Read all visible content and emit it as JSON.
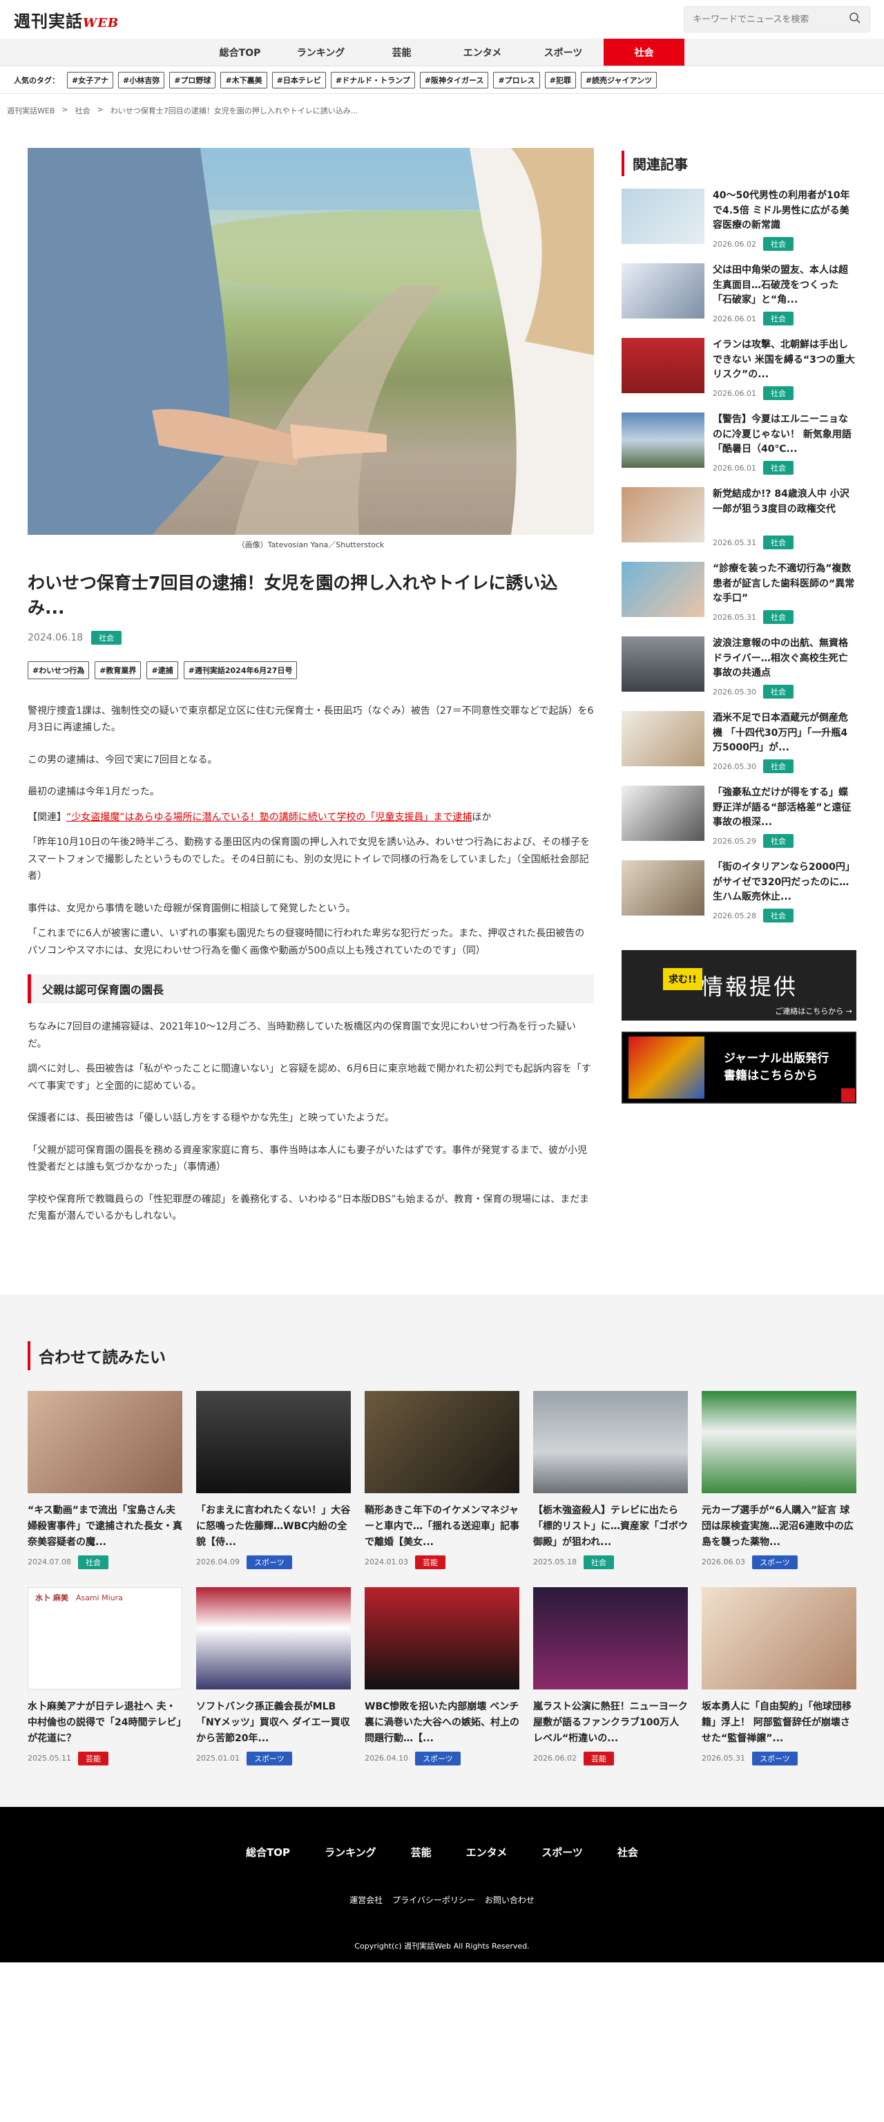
{
  "header": {
    "logo_text": "週刊実話",
    "logo_web": "WEB",
    "search_placeholder": "キーワードでニュースを検索"
  },
  "nav": {
    "items": [
      "総合TOP",
      "ランキング",
      "芸能",
      "エンタメ",
      "スポーツ",
      "社会"
    ],
    "active": "社会"
  },
  "popular_tags": {
    "label": "人気のタグ：",
    "items": [
      "#女子アナ",
      "#小林吉弥",
      "#プロ野球",
      "#木下裏美",
      "#日本テレビ",
      "#ドナルド・トランプ",
      "#阪神タイガース",
      "#プロレス",
      "#犯罪",
      "#読売ジャイアンツ"
    ]
  },
  "breadcrumb": {
    "items": [
      "週刊実話WEB",
      "社会",
      "わいせつ保育士7回目の逮捕！女児を園の押し入れやトイレに誘い込み..."
    ],
    "separator": ">"
  },
  "article": {
    "image_caption": "（画像）Tatevosian Yana／Shutterstock",
    "title": "わいせつ保育士7回目の逮捕！女児を園の押し入れやトイレに誘い込み...",
    "date": "2024.06.18",
    "category": "社会",
    "tags": [
      "#わいせつ行為",
      "#教育業界",
      "#逮捕",
      "#週刊実話2024年6月27日号"
    ],
    "p1": "警視庁捜査1課は、強制性交の疑いで東京都足立区に住む元保育士・長田凪巧（なぐみ）被告（27＝不同意性交罪などで起訴）を6月3日に再逮捕した。",
    "p2": "この男の逮捕は、今回で実に7回目となる。",
    "p3": "最初の逮捕は今年1月だった。",
    "related_prefix": "【関連】",
    "related_link": "“少女盗撮魔”はあらゆる場所に潜んでいる！塾の講師に続いて学校の「児童支援員」まで逮捕",
    "related_suffix": "ほか",
    "p4": "「昨年10月10日の午後2時半ごろ、勤務する墨田区内の保育園の押し入れで女児を誘い込み、わいせつ行為におよび、その様子をスマートフォンで撮影したというものでした。その4日前にも、別の女児にトイレで同様の行為をしていました」（全国紙社会部記者）",
    "p5": "事件は、女児から事情を聴いた母親が保育園側に相談して発覚したという。",
    "p6": "「これまでに6人が被害に遭い、いずれの事案も園児たちの昼寝時間に行われた卑劣な犯行だった。また、押収された長田被告のパソコンやスマホには、女児にわいせつ行為を働く画像や動画が500点以上も残されていたのです」（同）",
    "h2": "父親は認可保育園の園長",
    "p7": "ちなみに7回目の逮捕容疑は、2021年10～12月ごろ、当時勤務していた板橋区内の保育園で女児にわいせつ行為を行った疑いだ。",
    "p8": "調べに対し、長田被告は「私がやったことに間違いない」と容疑を認め、6月6日に東京地裁で開かれた初公判でも起訴内容を「すべて事実です」と全面的に認めている。",
    "p9": "保護者には、長田被告は「優しい話し方をする穏やかな先生」と映っていたようだ。",
    "p10": "「父親が認可保育園の園長を務める資産家家庭に育ち、事件当時は本人にも妻子がいたはずです。事件が発覚するまで、彼が小児性愛者だとは誰も気づかなかった」（事情通）",
    "p11": "学校や保育所で教職員らの「性犯罪歴の確認」を義務化する、いわゆる“日本版DBS”も始まるが、教育・保育の現場には、まだまだ鬼畜が潜んでいるかもしれない。"
  },
  "sidebar": {
    "title": "関連記事",
    "items": [
      {
        "title": "40～50代男性の利用者が10年で4.5倍 ミドル男性に広がる美容医療の新常識",
        "date": "2026.06.02",
        "cat": "社会"
      },
      {
        "title": "父は田中角栄の盟友、本人は超生真面目…石破茂をつくった「石破家」と“角...",
        "date": "2026.06.01",
        "cat": "社会"
      },
      {
        "title": "イランは攻撃、北朝鮮は手出しできない 米国を縛る“3つの重大リスク”の...",
        "date": "2026.06.01",
        "cat": "社会"
      },
      {
        "title": "【警告】今夏はエルニーニョなのに冷夏じゃない！ 新気象用語「酷暑日（40℃...",
        "date": "2026.06.01",
        "cat": "社会"
      },
      {
        "title": "新党結成か!? 84歳浪人中 小沢一郎が狙う3度目の政権交代",
        "date": "2026.05.31",
        "cat": "社会"
      },
      {
        "title": "“診療を装った不適切行為”複数患者が証言した歯科医師の“異常な手口”",
        "date": "2026.05.31",
        "cat": "社会"
      },
      {
        "title": "波浪注意報の中の出航、無資格ドライバー…相次ぐ高校生死亡事故の共通点",
        "date": "2026.05.30",
        "cat": "社会"
      },
      {
        "title": "酒米不足で日本酒蔵元が倒産危機 「十四代30万円」「一升瓶4万5000円」が...",
        "date": "2026.05.30",
        "cat": "社会"
      },
      {
        "title": "「強豪私立だけが得をする」蝶野正洋が語る“部活格差”と遠征事故の根深...",
        "date": "2026.05.29",
        "cat": "社会"
      },
      {
        "title": "「街のイタリアンなら2000円」がサイゼで320円だったのに…生ハム販売休止...",
        "date": "2026.05.28",
        "cat": "社会"
      }
    ],
    "banner1": {
      "badge": "求む!!",
      "title": "情報提供",
      "link": "ご連絡はこちらから →"
    },
    "banner2": {
      "line1": "ジャーナル出版発行",
      "line2": "書籍はこちらから"
    }
  },
  "readmore": {
    "title": "合わせて読みたい",
    "cards": [
      {
        "title": "“キス動画”まで流出「宝島さん夫婦殺害事件」で逮捕された長女・真奈美容疑者の魔...",
        "date": "2024.07.08",
        "cat": "社会",
        "color": "#16a085"
      },
      {
        "title": "「おまえに言われたくない！」大谷に怒鳴った佐藤輝…WBC内紛の全貌【侍...",
        "date": "2026.04.09",
        "cat": "スポーツ",
        "color": "#2a5bbe"
      },
      {
        "title": "鞘形あきこ年下のイケメンマネジャーと車内で…「揺れる送迎車」記事で離婚【美女...",
        "date": "2024.01.03",
        "cat": "芸能",
        "color": "#d4141c"
      },
      {
        "title": "【栃木強盗殺人】テレビに出たら「標的リスト」に…資産家「ゴボウ御殿」が狙われ...",
        "date": "2025.05.18",
        "cat": "社会",
        "color": "#16a085"
      },
      {
        "title": "元カープ選手が“6人購入”証言 球団は尿検査実施…泥沼6連敗中の広島を襲った薬物...",
        "date": "2026.06.03",
        "cat": "スポーツ",
        "color": "#2a5bbe"
      },
      {
        "title": "水卜麻美アナが日テレ退社へ 夫・中村倫也の説得で「24時間テレビ」が花道に？",
        "date": "2025.05.11",
        "cat": "芸能",
        "color": "#d4141c"
      },
      {
        "title": "ソフトバンク孫正義会長がMLB「NYメッツ」買収へ ダイエー買収から苦節20年...",
        "date": "2025.01.01",
        "cat": "スポーツ",
        "color": "#2a5bbe"
      },
      {
        "title": "WBC惨敗を招いた内部崩壊 ベンチ裏に渦巻いた大谷への嫉妬、村上の問題行動…【...",
        "date": "2026.04.10",
        "cat": "スポーツ",
        "color": "#2a5bbe"
      },
      {
        "title": "嵐ラスト公演に熱狂！ニューヨーク屋敷が語るファンクラブ100万人レベル“桁違いの...",
        "date": "2026.06.02",
        "cat": "芸能",
        "color": "#d4141c"
      },
      {
        "title": "坂本勇人に「自由契約」「他球団移籍」浮上！ 阿部監督辞任が崩壊させた“監督禅譲”...",
        "date": "2026.05.31",
        "cat": "スポーツ",
        "color": "#2a5bbe"
      }
    ],
    "card6_overlay_jp": "水卜 麻美",
    "card6_overlay_en": "Asami Miura"
  },
  "footer": {
    "nav": [
      "総合TOP",
      "ランキング",
      "芸能",
      "エンタメ",
      "スポーツ",
      "社会"
    ],
    "links": [
      "運営会社",
      "プライバシーポリシー",
      "お問い合わせ"
    ],
    "copyright": "Copyright(c) 週刊実話Web All Rights Reserved."
  }
}
